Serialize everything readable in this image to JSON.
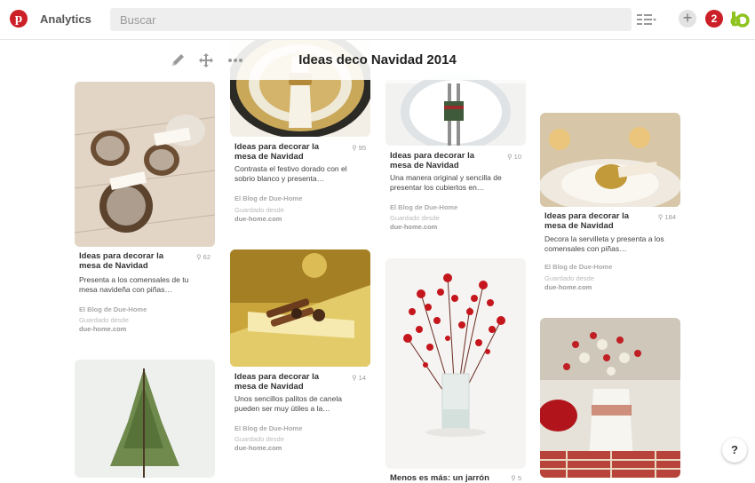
{
  "header": {
    "logo_letter": "p",
    "analytics_label": "Analytics",
    "search_placeholder": "Buscar",
    "notifications_count": "2",
    "plus_label": "+"
  },
  "board": {
    "title": "Ideas deco Navidad 2014"
  },
  "colors": {
    "brand": "#cb2027",
    "avatar_green": "#8fc31f"
  },
  "pins": [
    {
      "title": "Ideas para decorar la mesa de Navidad",
      "repins": "62",
      "description": "Presenta a los comensales de tu mesa navideña con piñas…",
      "by": "El Blog de Due-Home",
      "saved_label": "Guardado desde",
      "saved_source": "due-home.com"
    },
    {
      "title": "Ideas para decorar la mesa de Navidad",
      "repins": "95",
      "description": "Contrasta el festivo dorado con el sobrio blanco y presenta…",
      "by": "El Blog de Due-Home",
      "saved_label": "Guardado desde",
      "saved_source": "due-home.com"
    },
    {
      "title": "Ideas para decorar la mesa de Navidad",
      "repins": "14",
      "description": "Unos sencillos palitos de canela pueden ser muy útiles a la…",
      "by": "El Blog de Due-Home",
      "saved_label": "Guardado desde",
      "saved_source": "due-home.com"
    },
    {
      "title": "Ideas para decorar la mesa de Navidad",
      "repins": "10",
      "description": "Una manera original y sencilla de presentar los cubiertos en…",
      "by": "El Blog de Due-Home",
      "saved_label": "Guardado desde",
      "saved_source": "due-home.com"
    },
    {
      "title": "Menos es más: un jarrón",
      "repins": "5"
    },
    {
      "title": "Ideas para decorar la mesa de Navidad",
      "repins": "184",
      "description": "Decora la servilleta y presenta a los comensales con piñas…",
      "by": "El Blog de Due-Home",
      "saved_label": "Guardado desde",
      "saved_source": "due-home.com"
    }
  ],
  "help_label": "?",
  "icons": [
    "pinterest-logo-icon",
    "list-view-icon",
    "plus-icon",
    "notification-icon",
    "avatar-icon",
    "pencil-icon",
    "move-icon",
    "more-icon",
    "pin-icon",
    "help-icon"
  ]
}
